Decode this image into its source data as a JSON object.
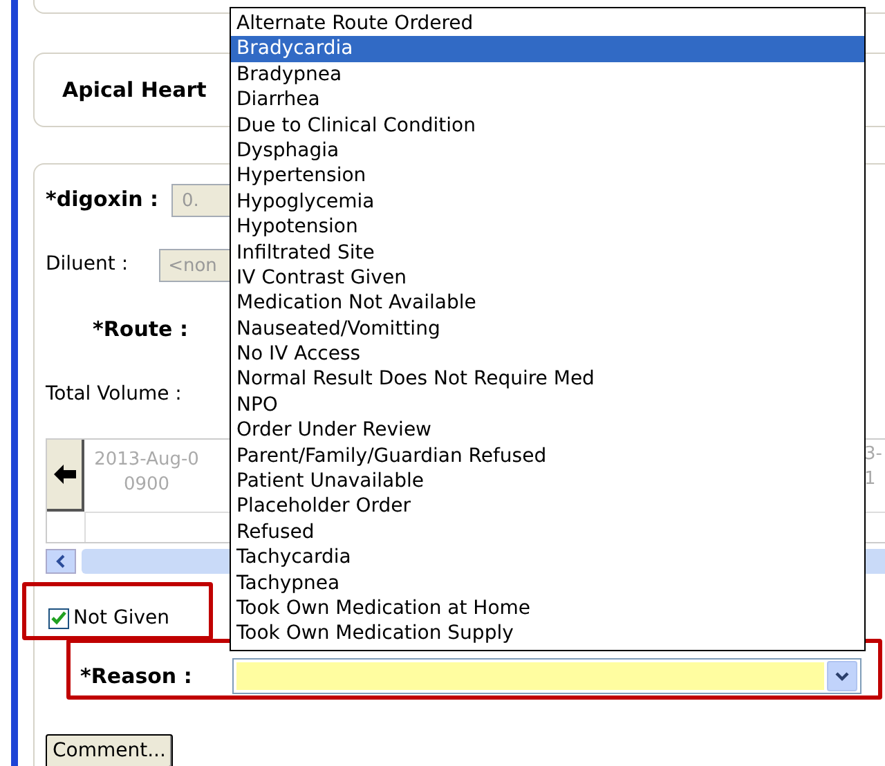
{
  "card_title": "Apical Heart",
  "form": {
    "dose_label": "*digoxin :",
    "dose_value": "0.",
    "diluent_label": "Diluent :",
    "diluent_value": "<non",
    "route_label": "*Route :",
    "total_volume_label": "Total Volume :"
  },
  "timeline": {
    "columns": [
      {
        "date": "2013-Aug-0",
        "time": "0900"
      },
      {
        "date": "3-",
        "time": "1"
      }
    ]
  },
  "not_given": {
    "label": "Not Given",
    "checked": true
  },
  "reason_label": "*Reason :",
  "comment_button": "Comment...",
  "reason_list": [
    {
      "label": "Alternate Route Ordered",
      "selected": false
    },
    {
      "label": "Bradycardia",
      "selected": true
    },
    {
      "label": "Bradypnea",
      "selected": false
    },
    {
      "label": "Diarrhea",
      "selected": false
    },
    {
      "label": "Due to Clinical Condition",
      "selected": false
    },
    {
      "label": "Dysphagia",
      "selected": false
    },
    {
      "label": "Hypertension",
      "selected": false
    },
    {
      "label": "Hypoglycemia",
      "selected": false
    },
    {
      "label": "Hypotension",
      "selected": false
    },
    {
      "label": "Infiltrated Site",
      "selected": false
    },
    {
      "label": "IV Contrast Given",
      "selected": false
    },
    {
      "label": "Medication Not Available",
      "selected": false
    },
    {
      "label": "Nauseated/Vomitting",
      "selected": false
    },
    {
      "label": "No IV Access",
      "selected": false
    },
    {
      "label": "Normal Result Does Not Require Med",
      "selected": false
    },
    {
      "label": "NPO",
      "selected": false
    },
    {
      "label": "Order Under Review",
      "selected": false
    },
    {
      "label": "Parent/Family/Guardian Refused",
      "selected": false
    },
    {
      "label": "Patient Unavailable",
      "selected": false
    },
    {
      "label": "Placeholder Order",
      "selected": false
    },
    {
      "label": "Refused",
      "selected": false
    },
    {
      "label": "Tachycardia",
      "selected": false
    },
    {
      "label": "Tachypnea",
      "selected": false
    },
    {
      "label": "Took Own Medication at Home",
      "selected": false
    },
    {
      "label": "Took Own Medication Supply",
      "selected": false
    }
  ]
}
